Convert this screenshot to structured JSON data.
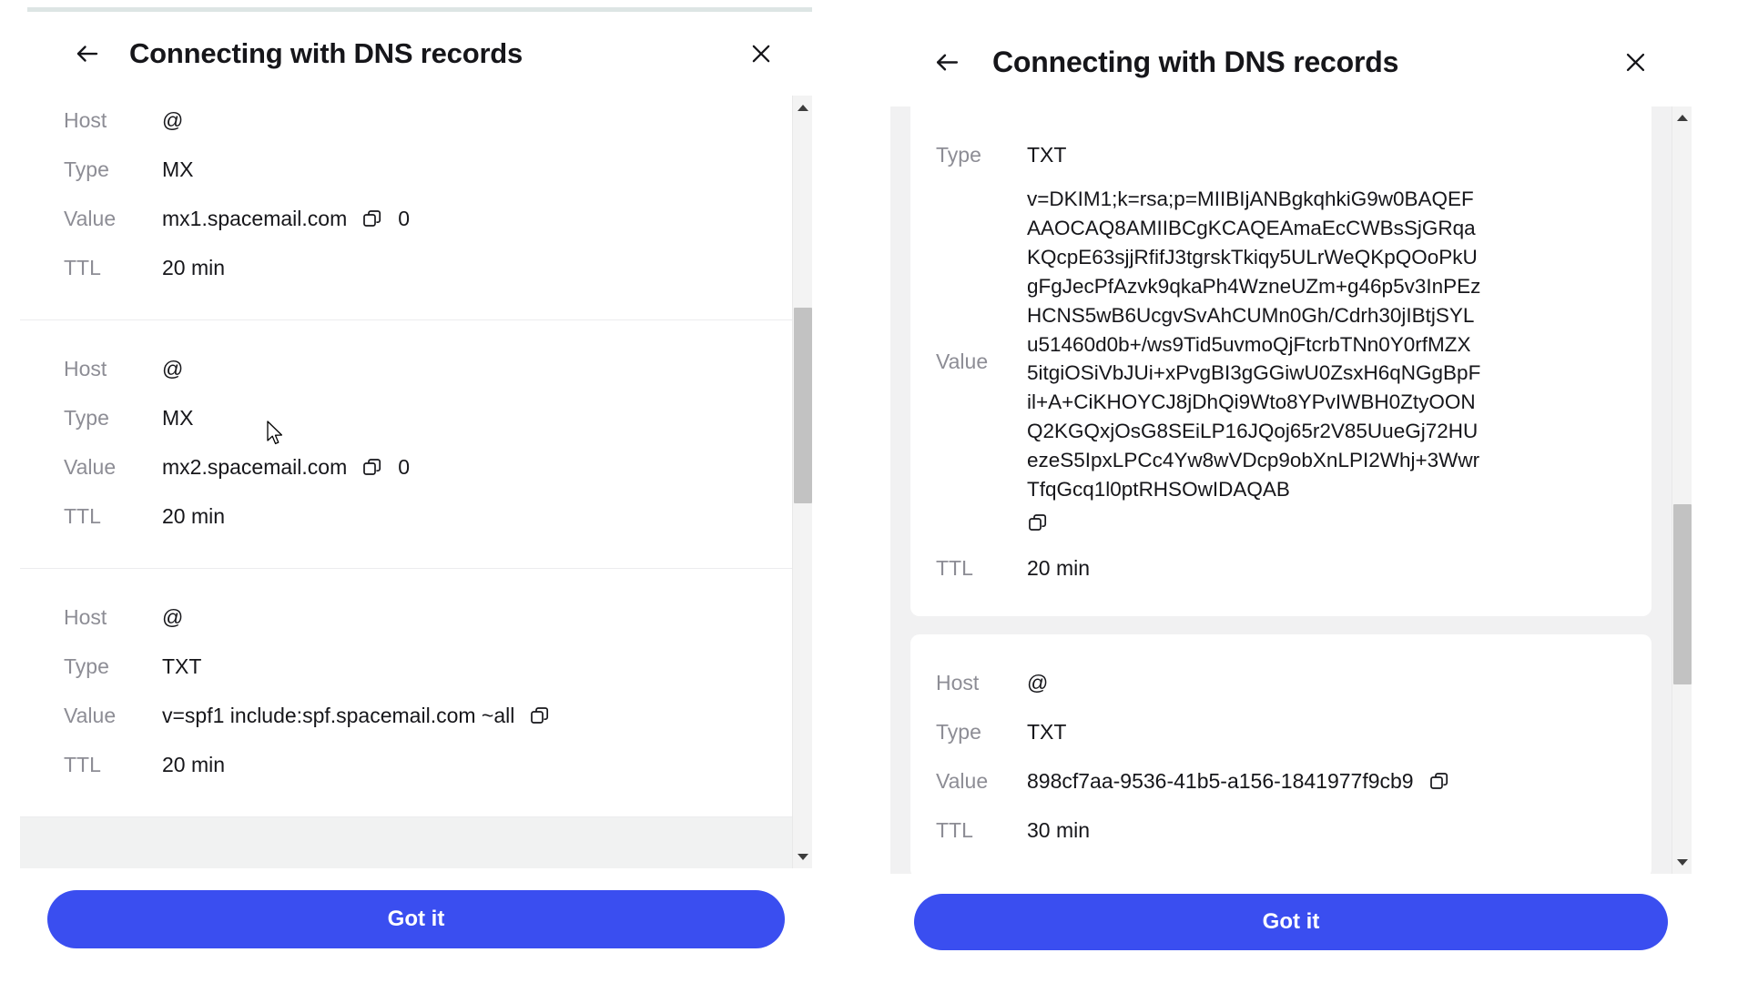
{
  "colors": {
    "accent": "#3a4ef0",
    "label_gray": "#8d8d95",
    "text": "#16161a",
    "page_bg": "#f1f2f2",
    "scroll_thumb": "#c2c2c2"
  },
  "panels": [
    {
      "id": "left",
      "header": {
        "title": "Connecting with DNS records",
        "back_icon": "arrow-left-icon",
        "close_icon": "close-icon"
      },
      "records": [
        {
          "rows": [
            {
              "label": "Host",
              "value": "@",
              "copy": false,
              "priority": null
            },
            {
              "label": "Type",
              "value": "MX",
              "copy": false,
              "priority": null
            },
            {
              "label": "Value",
              "value": "mx1.spacemail.com",
              "copy": true,
              "priority": "0"
            },
            {
              "label": "TTL",
              "value": "20 min",
              "copy": false,
              "priority": null
            }
          ]
        },
        {
          "rows": [
            {
              "label": "Host",
              "value": "@",
              "copy": false,
              "priority": null
            },
            {
              "label": "Type",
              "value": "MX",
              "copy": false,
              "priority": null
            },
            {
              "label": "Value",
              "value": "mx2.spacemail.com",
              "copy": true,
              "priority": "0"
            },
            {
              "label": "TTL",
              "value": "20 min",
              "copy": false,
              "priority": null
            }
          ]
        },
        {
          "rows": [
            {
              "label": "Host",
              "value": "@",
              "copy": false,
              "priority": null
            },
            {
              "label": "Type",
              "value": "TXT",
              "copy": false,
              "priority": null
            },
            {
              "label": "Value",
              "value": "v=spf1 include:spf.spacemail.com ~all",
              "copy": true,
              "priority": null
            },
            {
              "label": "TTL",
              "value": "20 min",
              "copy": false,
              "priority": null
            }
          ]
        }
      ],
      "footer": {
        "cta_label": "Got it"
      },
      "scrollbar": {
        "thumb_top_pct": 26,
        "thumb_height_pct": 27
      }
    },
    {
      "id": "right",
      "header": {
        "title": "Connecting with DNS records",
        "back_icon": "arrow-left-icon",
        "close_icon": "close-icon"
      },
      "records": [
        {
          "rows": [
            {
              "label": "Type",
              "value": "TXT",
              "copy": false,
              "priority": null
            },
            {
              "label": "Value",
              "value": "v=DKIM1;k=rsa;p=MIIBIjANBgkqhkiG9w0BAQEFAAOCAQ8AMIIBCgKCAQEAmaEcCWBsSjGRqaKQcpE63sjjRfifJ3tgrskTkiqy5ULrWeQKpQOoPkUgFgJecPfAzvk9qkaPh4WzneUZm+g46p5v3InPEzHCNS5wB6UcgvSvAhCUMn0Gh/Cdrh30jIBtjSYLu51460d0b+/ws9Tid5uvmoQjFtcrbTNn0Y0rfMZX5itgiOSiVbJUi+xPvgBI3gGGiwU0ZsxH6qNGgBpFil+A+CiKHOYCJ8jDhQi9Wto8YPvIWBH0ZtyOONQ2KGQxjOsG8SEiLP16JQoj65r2V85UueGj72HUezeS5IpxLPCc4Yw8wVDcp9obXnLPI2Whj+3WwrTfqGcq1l0ptRHSOwIDAQAB",
              "copy": true,
              "multiline": true,
              "priority": null
            },
            {
              "label": "TTL",
              "value": "20 min",
              "copy": false,
              "priority": null
            }
          ]
        },
        {
          "rows": [
            {
              "label": "Host",
              "value": "@",
              "copy": false,
              "priority": null
            },
            {
              "label": "Type",
              "value": "TXT",
              "copy": false,
              "priority": null
            },
            {
              "label": "Value",
              "value": "898cf7aa-9536-41b5-a156-1841977f9cb9",
              "copy": true,
              "priority": null
            },
            {
              "label": "TTL",
              "value": "30 min",
              "copy": false,
              "priority": null
            }
          ]
        }
      ],
      "footer": {
        "cta_label": "Got it"
      },
      "scrollbar": {
        "thumb_top_pct": 52,
        "thumb_height_pct": 25
      }
    }
  ]
}
